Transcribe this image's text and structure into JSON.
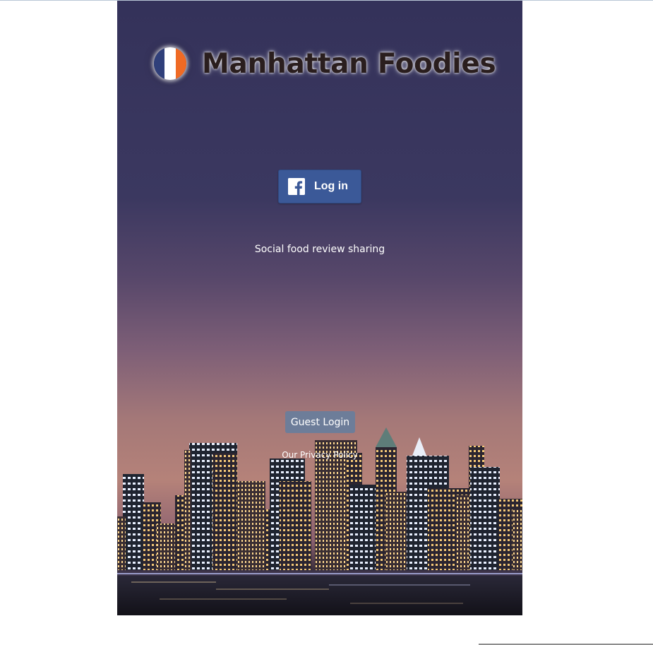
{
  "app": {
    "title": "Manhattan Foodies"
  },
  "logo": {
    "icon": "flag-circle-icon",
    "flag_colors": [
      "#2f3f7a",
      "#ffffff",
      "#ef6a24"
    ]
  },
  "facebook_login": {
    "label": "Log in",
    "icon": "facebook-icon",
    "color": "#3b5998"
  },
  "tagline": "Social food review sharing",
  "guest_login": {
    "label": "Guest Login",
    "color": "#6d7d99"
  },
  "privacy_link": "Our Privacy Policy",
  "background": {
    "image": "city-skyline-at-dusk"
  }
}
